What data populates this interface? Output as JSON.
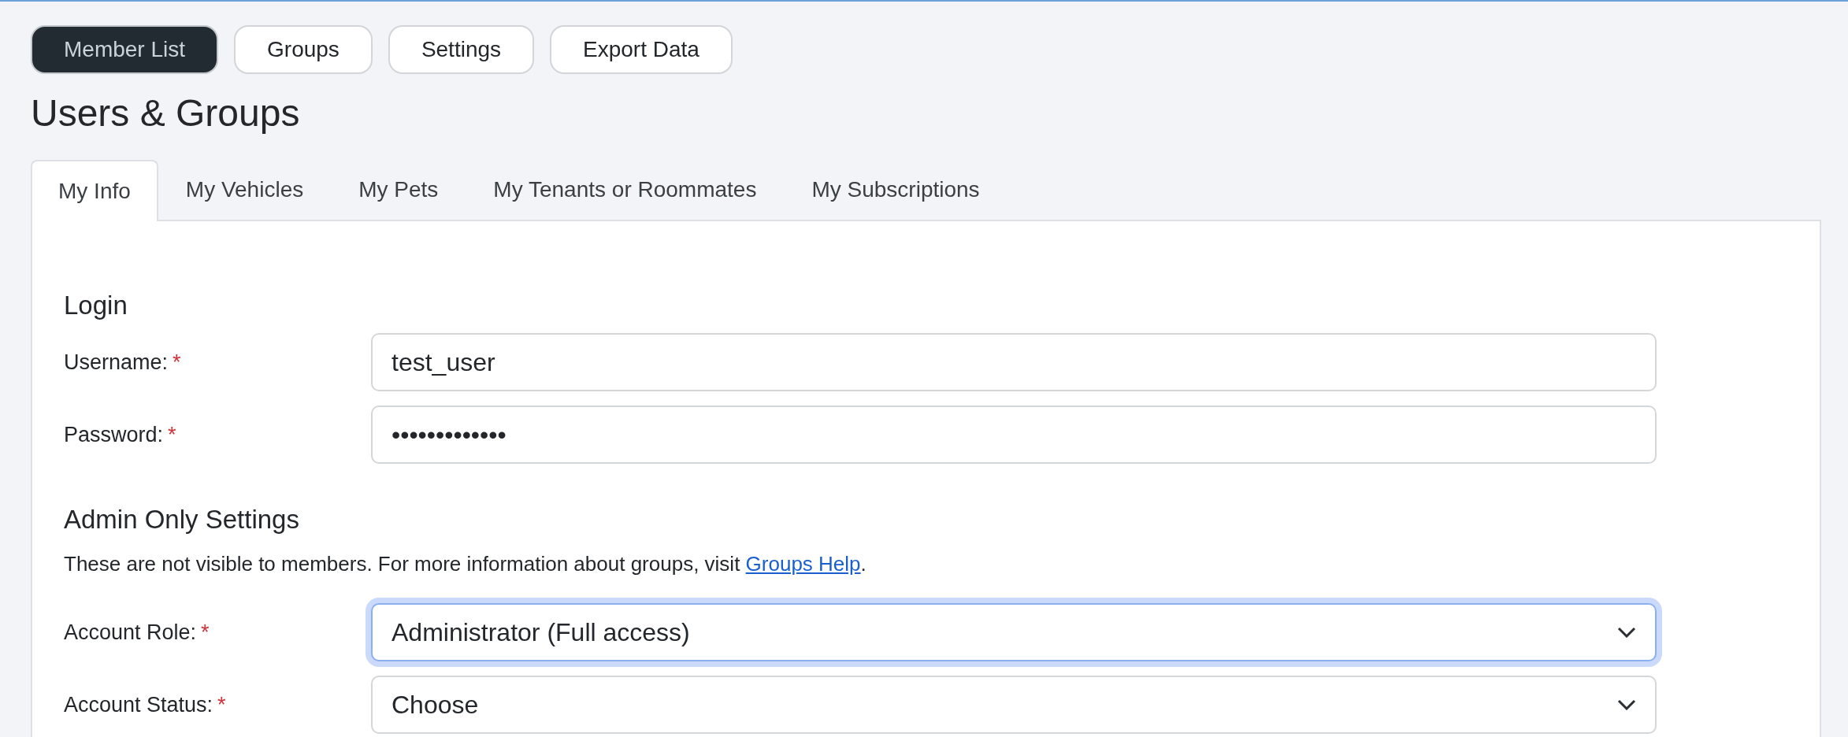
{
  "nav_buttons": [
    {
      "label": "Member List",
      "selected": true
    },
    {
      "label": "Groups",
      "selected": false
    },
    {
      "label": "Settings",
      "selected": false
    },
    {
      "label": "Export Data",
      "selected": false
    }
  ],
  "title": "Users & Groups",
  "tabs": [
    {
      "label": "My Info",
      "selected": true
    },
    {
      "label": "My Vehicles",
      "selected": false
    },
    {
      "label": "My Pets",
      "selected": false
    },
    {
      "label": "My Tenants or Roommates",
      "selected": false
    },
    {
      "label": "My Subscriptions",
      "selected": false
    }
  ],
  "sections": [
    {
      "heading": "Login",
      "fields": [
        {
          "kind": "text",
          "label": "Username:",
          "required_mark": "*",
          "value": "test_user",
          "focused": false
        },
        {
          "kind": "text",
          "label": "Password:",
          "required_mark": "*",
          "value": "•••••••••••••",
          "focused": false
        }
      ]
    },
    {
      "heading": "Admin Only Settings",
      "note": {
        "text": "These are not visible to members. For more information about groups, visit ",
        "link": "Groups Help",
        "after": "."
      },
      "fields": [
        {
          "kind": "select",
          "label": "Account Role:",
          "required_mark": "*",
          "value": "Administrator (Full access)",
          "focused": true
        },
        {
          "kind": "select",
          "label": "Account Status:",
          "required_mark": "*",
          "value": "Choose",
          "focused": false
        }
      ]
    }
  ]
}
